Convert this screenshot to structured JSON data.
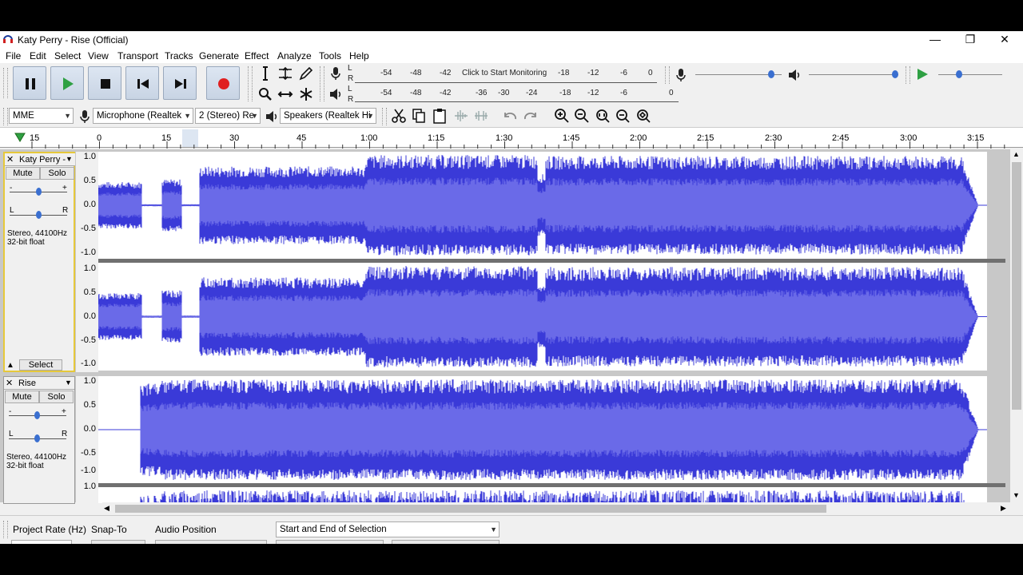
{
  "window": {
    "title": "Katy Perry - Rise (Official)",
    "minimize": "—",
    "restore": "❐",
    "close": "✕"
  },
  "menu": [
    "File",
    "Edit",
    "Select",
    "View",
    "Transport",
    "Tracks",
    "Generate",
    "Effect",
    "Analyze",
    "Tools",
    "Help"
  ],
  "transport": {
    "pause": "pause-icon",
    "play": "play-icon",
    "stop": "stop-icon",
    "skip_start": "skip-start-icon",
    "skip_end": "skip-end-icon",
    "record": "record-icon",
    "accent_play": "#2ea043",
    "accent_record": "#e02020"
  },
  "meters": {
    "record_ticks": [
      "-54",
      "-48",
      "-42",
      "Click to Start Monitoring",
      "-18",
      "-12",
      "-6",
      "0"
    ],
    "play_ticks": [
      "-54",
      "-48",
      "-42",
      "-36",
      "-30",
      "-24",
      "-18",
      "-12",
      "-6",
      "0"
    ],
    "lr": [
      "L",
      "R"
    ]
  },
  "devices": {
    "host": "MME",
    "input": "Microphone (Realtek",
    "channels": "2 (Stereo) Re",
    "output": "Speakers (Realtek Hi"
  },
  "ruler": {
    "labels": [
      "15",
      "0",
      "15",
      "30",
      "45",
      "1:00",
      "1:15",
      "1:30",
      "1:45",
      "2:00",
      "2:15",
      "2:30",
      "2:45",
      "3:00",
      "3:15"
    ]
  },
  "tracks": [
    {
      "name": "Katy Perry -",
      "mute": "Mute",
      "solo": "Solo",
      "info1": "Stereo, 44100Hz",
      "info2": "32-bit float",
      "select": "Select",
      "gain_minus": "-",
      "gain_plus": "+",
      "pan_l": "L",
      "pan_r": "R"
    },
    {
      "name": "Rise",
      "mute": "Mute",
      "solo": "Solo",
      "info1": "Stereo, 44100Hz",
      "info2": "32-bit float",
      "gain_minus": "-",
      "gain_plus": "+",
      "pan_l": "L",
      "pan_r": "R"
    }
  ],
  "scale": [
    "1.0",
    "0.5",
    "0.0",
    "-0.5",
    "-1.0"
  ],
  "wave_color": "#3a3ad8",
  "status": {
    "project_rate": "Project Rate (Hz)",
    "snap_to": "Snap-To",
    "audio_position": "Audio Position",
    "selection_mode": "Start and End of Selection"
  }
}
